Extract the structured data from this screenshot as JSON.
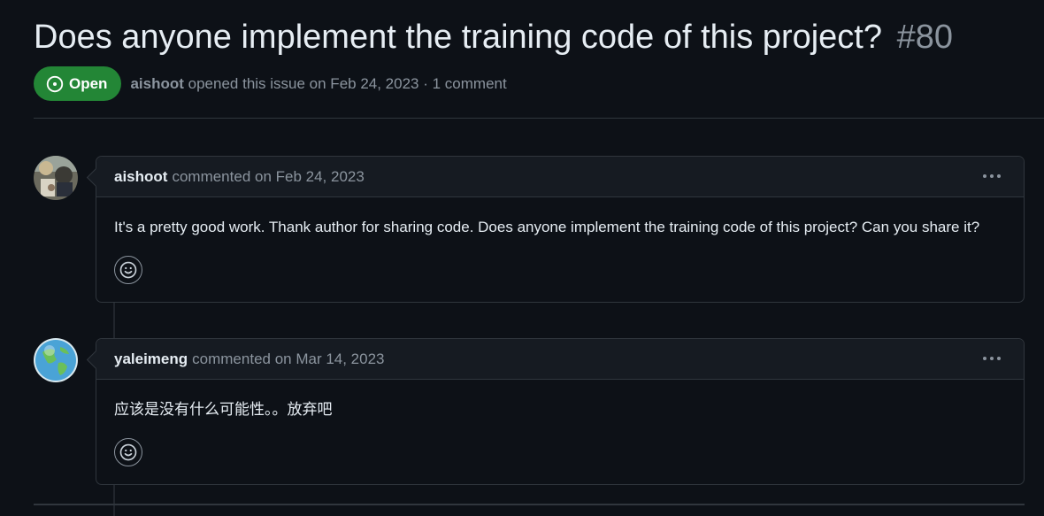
{
  "issue": {
    "title": "Does anyone implement the training code of this project?",
    "number": "#80",
    "state": "Open",
    "author": "aishoot",
    "meta_text": "opened this issue on Feb 24, 2023 · 1 comment"
  },
  "comments": [
    {
      "author": "aishoot",
      "meta": "commented on Feb 24, 2023",
      "body": "It's a pretty good work. Thank author for sharing code. Does anyone implement the training code of this project? Can you share it?",
      "avatar_icon": "avatar-photo"
    },
    {
      "author": "yaleimeng",
      "meta": "commented on Mar 14, 2023",
      "body": "应该是没有什么可能性。。放弃吧",
      "avatar_icon": "globe-avatar"
    }
  ],
  "icons": {
    "state": "issue-opened-icon",
    "menu": "kebab-horizontal-icon",
    "reaction": "smiley-icon"
  },
  "colors": {
    "open_badge": "#238636",
    "background": "#0d1117",
    "header_bg": "#161b22",
    "border": "#30363d",
    "muted_text": "#8b949e"
  }
}
